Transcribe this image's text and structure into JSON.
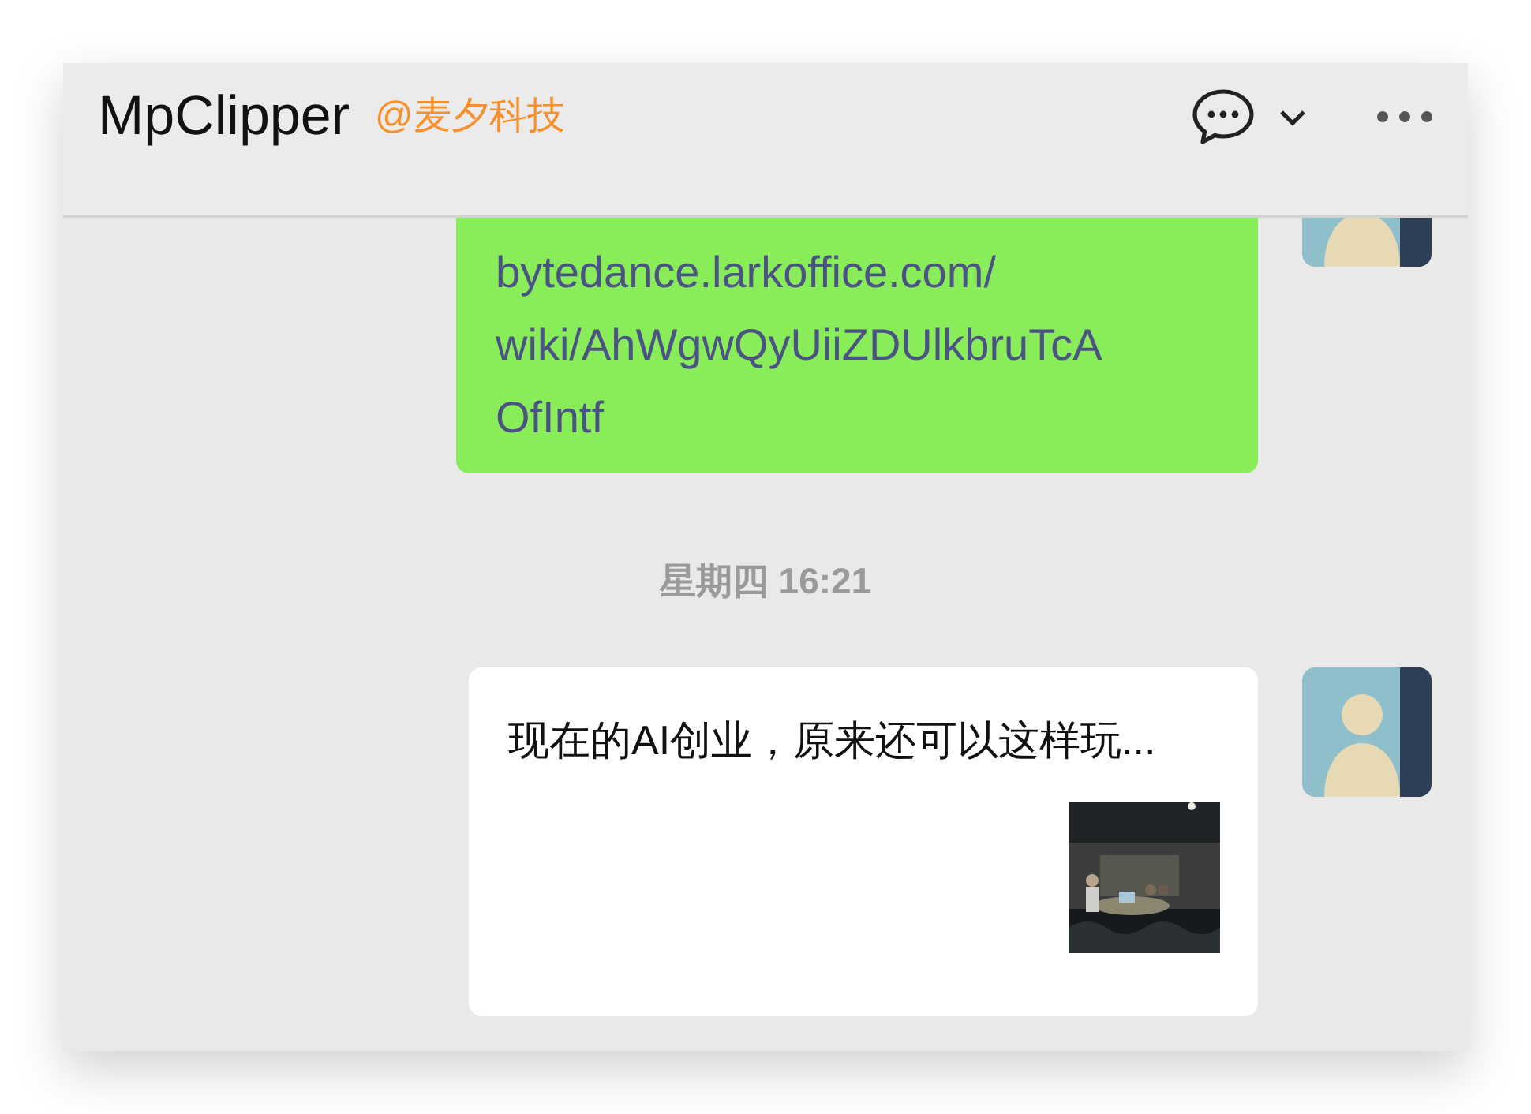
{
  "header": {
    "title": "MpClipper",
    "subtitle": "@麦夕科技"
  },
  "messages": [
    {
      "kind": "link",
      "lines": [
        "bytedance.larkoffice.com/",
        "wiki/AhWgwQyUiiZDUlkbruTcA",
        "OfIntf"
      ]
    },
    {
      "kind": "time",
      "text": "星期四 16:21"
    },
    {
      "kind": "article",
      "text": "现在的AI创业，原来还可以这样玩..."
    }
  ]
}
